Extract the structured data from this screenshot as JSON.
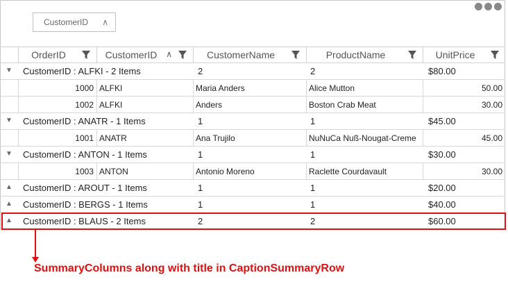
{
  "grouping_area": {
    "chip_label": "CustomerID"
  },
  "columns": [
    {
      "name": "OrderID"
    },
    {
      "name": "CustomerID"
    },
    {
      "name": "CustomerName"
    },
    {
      "name": "ProductName"
    },
    {
      "name": "UnitPrice"
    }
  ],
  "rows": [
    {
      "kind": "caption",
      "expanded": true,
      "title": "CustomerID : ALFKI - 2 Items",
      "col3": "2",
      "col4": "2",
      "col5": "$80.00"
    },
    {
      "kind": "record",
      "order": "1000",
      "cust": "ALFKI",
      "name": "Maria Anders",
      "product": "Alice Mutton",
      "price": "50.00"
    },
    {
      "kind": "record",
      "order": "1002",
      "cust": "ALFKI",
      "name": "Anders",
      "product": "Boston Crab Meat",
      "price": "30.00"
    },
    {
      "kind": "caption",
      "expanded": true,
      "title": "CustomerID : ANATR - 1 Items",
      "col3": "1",
      "col4": "1",
      "col5": "$45.00"
    },
    {
      "kind": "record",
      "order": "1001",
      "cust": "ANATR",
      "name": "Ana Trujilo",
      "product": "NuNuCa Nuß-Nougat-Creme",
      "price": "45.00"
    },
    {
      "kind": "caption",
      "expanded": true,
      "title": "CustomerID : ANTON - 1 Items",
      "col3": "1",
      "col4": "1",
      "col5": "$30.00"
    },
    {
      "kind": "record",
      "order": "1003",
      "cust": "ANTON",
      "name": "Antonio Moreno",
      "product": "Raclette Courdavault",
      "price": "30.00"
    },
    {
      "kind": "caption",
      "expanded": false,
      "title": "CustomerID : AROUT - 1 Items",
      "col3": "1",
      "col4": "1",
      "col5": "$20.00"
    },
    {
      "kind": "caption",
      "expanded": false,
      "title": "CustomerID : BERGS - 1 Items",
      "col3": "1",
      "col4": "1",
      "col5": "$40.00"
    },
    {
      "kind": "caption",
      "expanded": false,
      "title": "CustomerID : BLAUS - 2 Items",
      "col3": "2",
      "col4": "2",
      "col5": "$60.00"
    }
  ],
  "annotation": {
    "text": "SummaryColumns along with title in CaptionSummaryRow",
    "color": "#e01010"
  }
}
